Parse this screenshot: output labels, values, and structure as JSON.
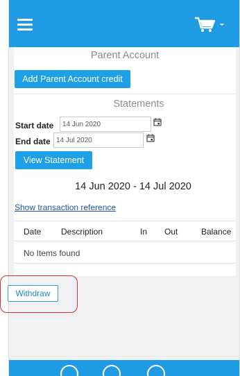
{
  "header": {
    "menu_icon": "hamburger-icon",
    "cart_icon": "shopping-cart-icon"
  },
  "page": {
    "title": "Parent Account",
    "add_credit_label": "Add Parent Account credit"
  },
  "statements": {
    "heading": "Statements",
    "start_label": "Start date",
    "start_value": "14 Jun 2020",
    "end_label": "End date",
    "end_value": "14 Jul 2020",
    "view_label": "View Statement",
    "range": "14 Jun 2020 - 14 Jul 2020",
    "show_ref_label": "Show transaction reference",
    "columns": [
      "Date",
      "Description",
      "In",
      "Out",
      "Balance"
    ],
    "empty_text": "No Items found"
  },
  "actions": {
    "withdraw_label": "Withdraw"
  },
  "colors": {
    "brand": "#1e9be2",
    "link": "#1a57a8",
    "highlight": "#d22f2f"
  }
}
